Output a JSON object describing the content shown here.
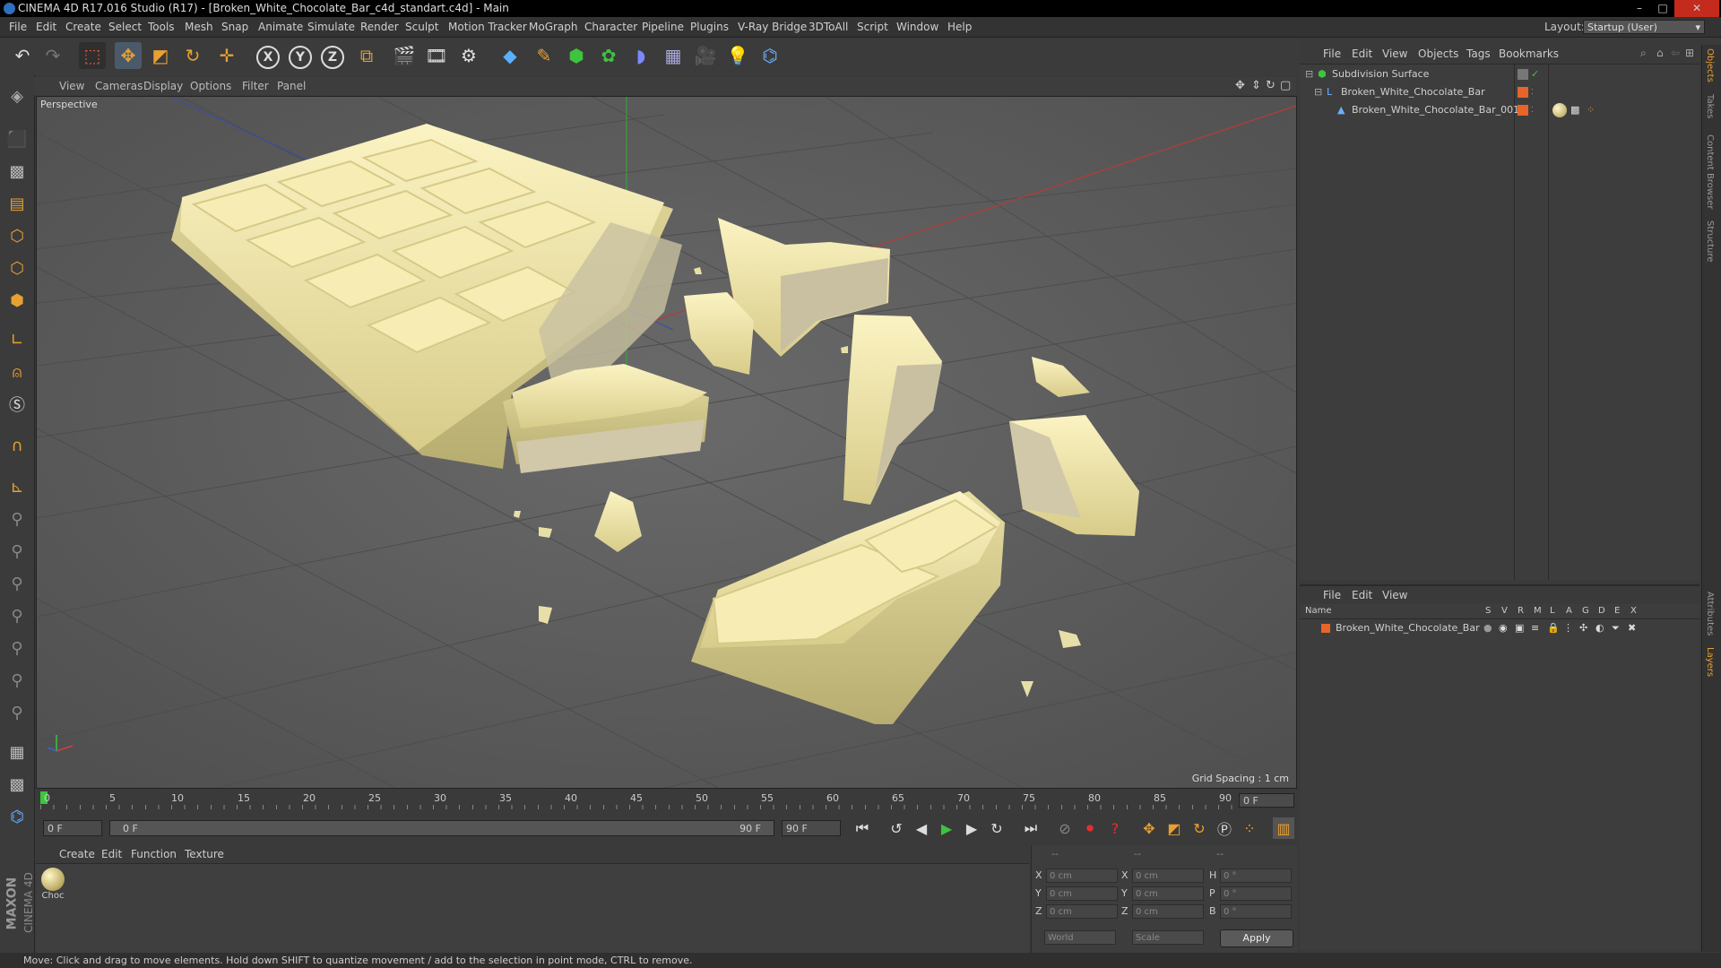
{
  "window": {
    "title": "CINEMA 4D R17.016 Studio (R17) - [Broken_White_Chocolate_Bar_c4d_standart.c4d] - Main",
    "controls": [
      "–",
      "□",
      "✕"
    ]
  },
  "menubar": {
    "items": [
      "File",
      "Edit",
      "Create",
      "Select",
      "Tools",
      "Mesh",
      "Snap",
      "Animate",
      "Simulate",
      "Render",
      "Sculpt",
      "Motion Tracker",
      "MoGraph",
      "Character",
      "Pipeline",
      "Plugins",
      "V-Ray Bridge",
      "3DToAll",
      "Script",
      "Window",
      "Help"
    ],
    "layout_label": "Layout:",
    "layout_value": "Startup (User)"
  },
  "toolbar": {
    "xyz": [
      "X",
      "Y",
      "Z"
    ]
  },
  "viewport": {
    "menu": [
      "View",
      "Cameras",
      "Display",
      "Options",
      "Filter",
      "Panel"
    ],
    "camera_label": "Perspective",
    "grid_spacing": "Grid Spacing : 1 cm"
  },
  "timeline": {
    "ticks": [
      "0",
      "5",
      "10",
      "15",
      "20",
      "25",
      "30",
      "35",
      "40",
      "45",
      "50",
      "55",
      "60",
      "65",
      "70",
      "75",
      "80",
      "85",
      "90"
    ],
    "current_frame": "0 F",
    "start_field": "0 F",
    "range_start": "0 F",
    "range_end": "90 F",
    "end_field": "90 F"
  },
  "materials": {
    "menu": [
      "Create",
      "Edit",
      "Function",
      "Texture"
    ],
    "items": [
      {
        "label": "Choc"
      }
    ]
  },
  "coords": {
    "headers": [
      "--",
      "--",
      "--"
    ],
    "rows": [
      {
        "l1": "X",
        "v1": "0 cm",
        "l2": "X",
        "v2": "0 cm",
        "l3": "H",
        "v3": "0 °"
      },
      {
        "l1": "Y",
        "v1": "0 cm",
        "l2": "Y",
        "v2": "0 cm",
        "l3": "P",
        "v3": "0 °"
      },
      {
        "l1": "Z",
        "v1": "0 cm",
        "l2": "Z",
        "v2": "0 cm",
        "l3": "B",
        "v3": "0 °"
      }
    ],
    "mode": "World",
    "scale": "Scale",
    "apply": "Apply"
  },
  "status": {
    "text": "Move: Click and drag to move elements. Hold down SHIFT to quantize movement / add to the selection in point mode, CTRL to remove."
  },
  "objects": {
    "menu": [
      "File",
      "Edit",
      "View",
      "Objects",
      "Tags",
      "Bookmarks"
    ],
    "rows": [
      {
        "name": "Subdivision Surface"
      },
      {
        "name": "Broken_White_Chocolate_Bar"
      },
      {
        "name": "Broken_White_Chocolate_Bar_001"
      }
    ]
  },
  "layers": {
    "menu": [
      "File",
      "Edit",
      "View"
    ],
    "header_name": "Name",
    "columns": [
      "S",
      "V",
      "R",
      "M",
      "L",
      "A",
      "G",
      "D",
      "E",
      "X"
    ],
    "rows": [
      {
        "name": "Broken_White_Chocolate_Bar"
      }
    ]
  },
  "side_tabs": [
    "Objects",
    "Takes",
    "Content Browser",
    "Structure",
    "Attributes",
    "Layers"
  ],
  "brand": {
    "maxon": "MAXON",
    "cinema": "CINEMA 4D"
  },
  "colors": {
    "accent": "#e8a032",
    "viewport_bg": "#5e5e5e",
    "chocolate": "#f0e6a8",
    "layer_color": "#e8642a"
  }
}
